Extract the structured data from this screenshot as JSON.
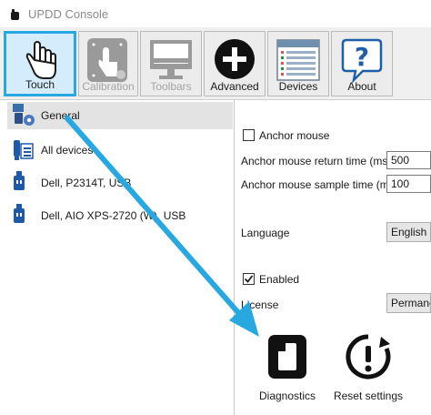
{
  "window": {
    "title": "UPDD Console"
  },
  "toolbar": {
    "items": [
      {
        "label": "Touch",
        "icon": "touch-hand-icon",
        "state": "selected"
      },
      {
        "label": "Calibration",
        "icon": "calibration-icon",
        "state": "disabled"
      },
      {
        "label": "Toolbars",
        "icon": "toolbars-monitor-icon",
        "state": "disabled"
      },
      {
        "label": "Advanced",
        "icon": "plus-circle-icon",
        "state": "normal"
      },
      {
        "label": "Devices",
        "icon": "devices-list-icon",
        "state": "normal"
      },
      {
        "label": "About",
        "icon": "question-icon",
        "state": "normal"
      }
    ]
  },
  "tree": {
    "items": [
      {
        "label": "General",
        "icon": "general-settings-icon",
        "selected": true
      },
      {
        "label": "All devices",
        "icon": "all-devices-icon",
        "selected": false
      },
      {
        "label": "Dell, P2314T, USB",
        "icon": "usb-icon",
        "selected": false
      },
      {
        "label": "Dell, AIO XPS-2720 (W), USB",
        "icon": "usb-icon",
        "selected": false
      }
    ]
  },
  "settings": {
    "anchor_mouse_label": "Anchor mouse",
    "anchor_mouse_checked": false,
    "return_time_label": "Anchor mouse return time (ms)",
    "return_time_value": "500",
    "sample_time_label": "Anchor mouse sample time (ms)",
    "sample_time_value": "100",
    "language_label": "Language",
    "language_value": "English",
    "enabled_label": "Enabled",
    "enabled_checked": true,
    "license_label": "License",
    "license_value": "Permanent"
  },
  "actions": {
    "diagnostics_label": "Diagnostics",
    "reset_label": "Reset settings"
  },
  "colors": {
    "accent": "#27a8e0",
    "selected_tool_bg": "#d4ecfb",
    "toolbar_bg": "#f0f0f0",
    "tree_selection": "#e3e3e3"
  }
}
